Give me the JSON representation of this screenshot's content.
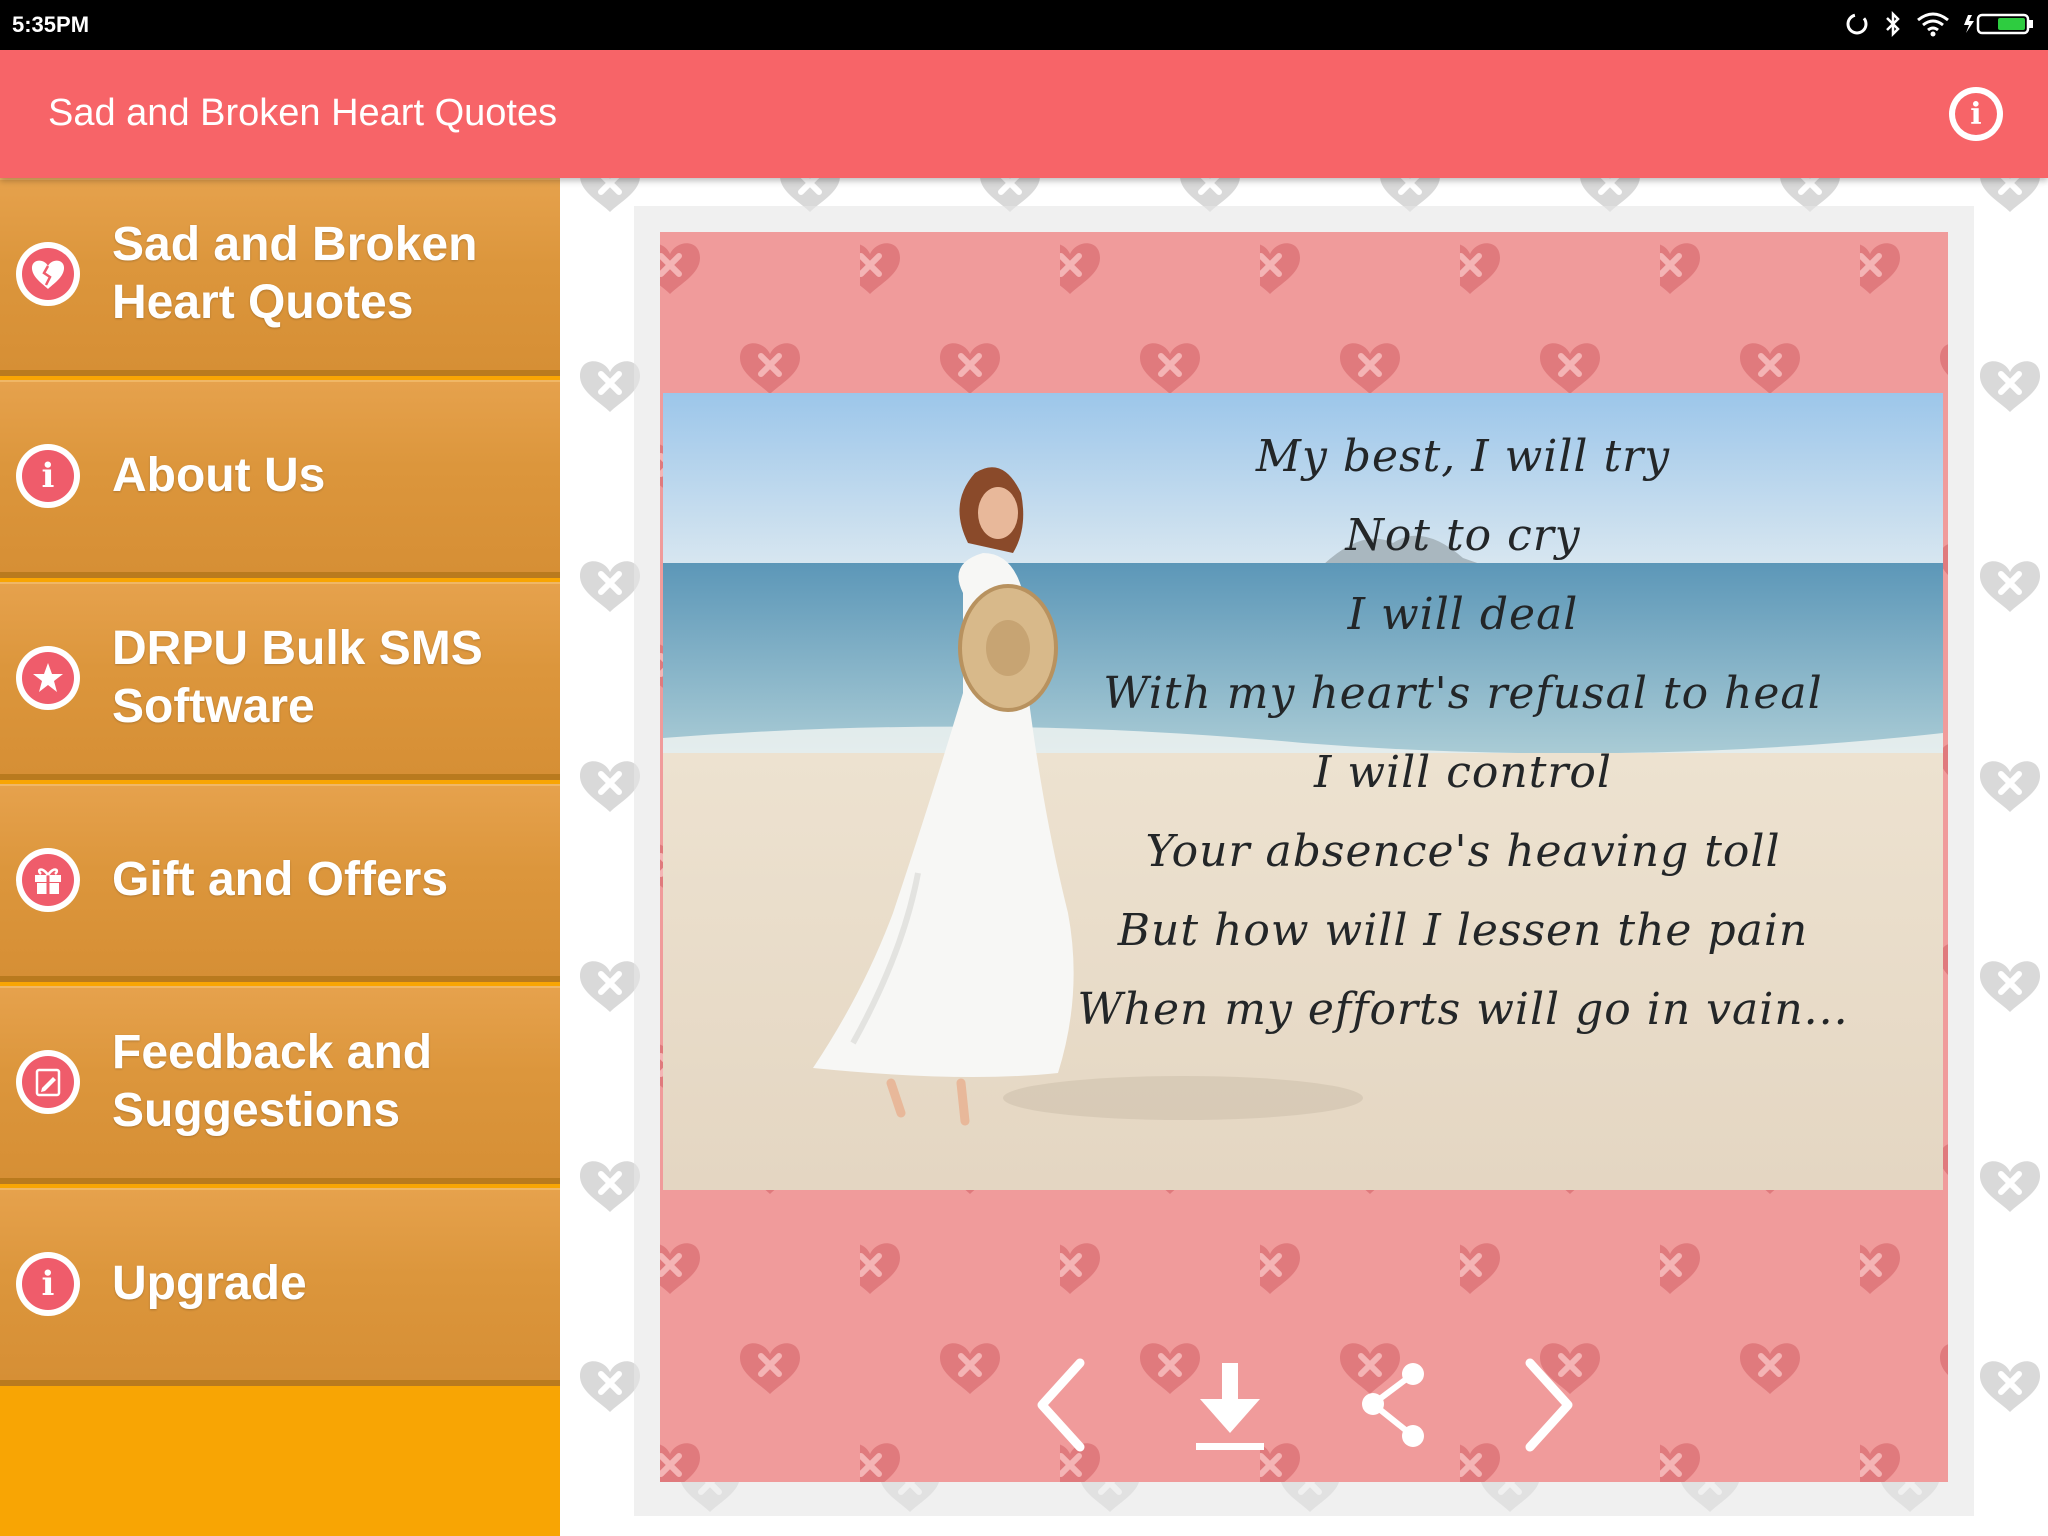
{
  "status_bar": {
    "time": "5:35PM"
  },
  "app_bar": {
    "title": "Sad and Broken Heart Quotes",
    "info_icon": "info-icon"
  },
  "sidebar": {
    "items": [
      {
        "label": "Sad and Broken Heart Quotes",
        "icon": "broken-heart-icon"
      },
      {
        "label": "About Us",
        "icon": "info-icon"
      },
      {
        "label": "DRPU Bulk SMS Software",
        "icon": "star-icon"
      },
      {
        "label": "Gift and Offers",
        "icon": "gift-icon"
      },
      {
        "label": "Feedback and Suggestions",
        "icon": "feedback-icon"
      },
      {
        "label": "Upgrade",
        "icon": "info-icon"
      }
    ]
  },
  "quote": {
    "lines": [
      "My best, I will try",
      "Not to cry",
      "I will deal",
      "With my heart's refusal to heal",
      "I will control",
      "Your absence's heaving toll",
      "But how will I lessen the pain",
      "When my efforts will go in vain..."
    ]
  },
  "actions": {
    "previous": "chevron-left-icon",
    "download": "download-icon",
    "share": "share-icon",
    "next": "chevron-right-icon"
  },
  "colors": {
    "app_bar": "#f76468",
    "sidebar_item": "#dc963c",
    "sidebar_bottom": "#f8a504",
    "card": "#f09b9b",
    "icon_circle": "#ef5c6b"
  }
}
